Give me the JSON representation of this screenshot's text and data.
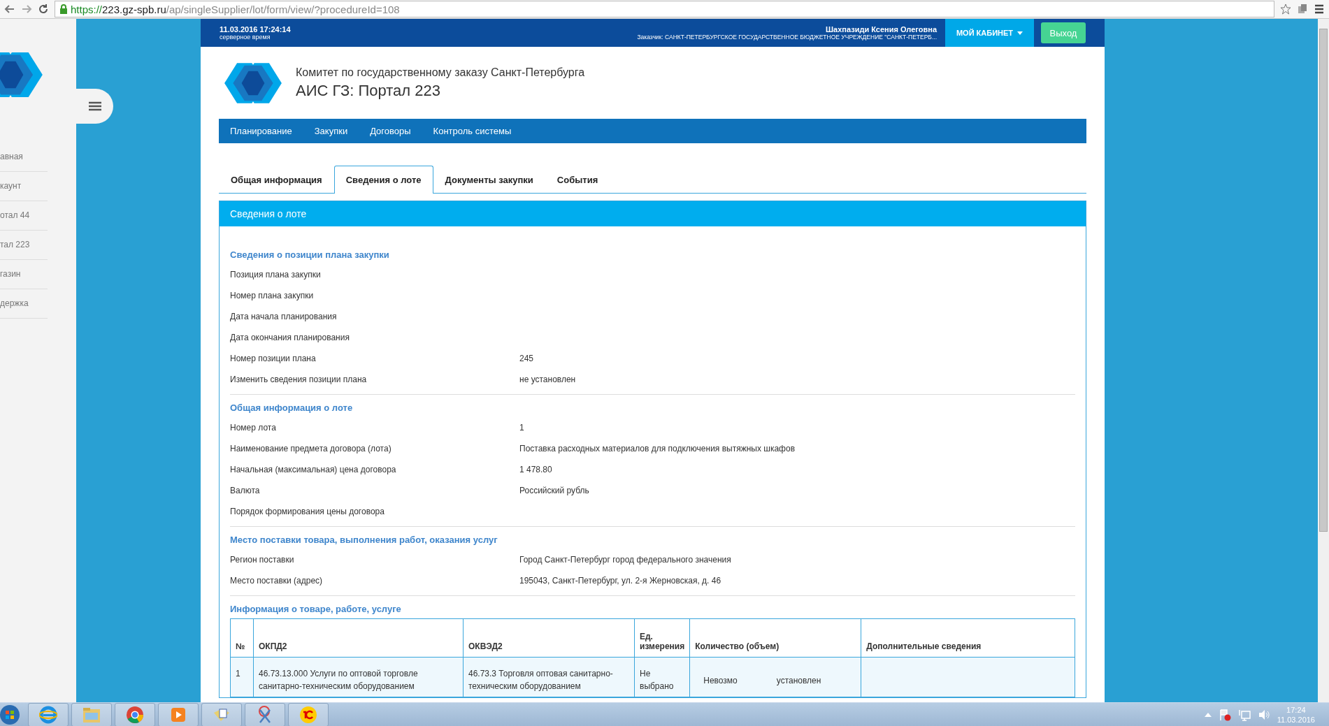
{
  "browser": {
    "url_scheme": "https://",
    "url_host": "223.gz-spb.ru",
    "url_path": "/ap/singleSupplier/lot/form/view/?procedureId=108"
  },
  "sidebar": {
    "items": [
      {
        "label": "авная"
      },
      {
        "label": "каунт"
      },
      {
        "label": "отал 44"
      },
      {
        "label": "тал 223"
      },
      {
        "label": "газин"
      },
      {
        "label": "держка"
      }
    ]
  },
  "topbar": {
    "datetime": "11.03.2016 17:24:14",
    "datetime_note": "серверное время",
    "user": "Шахпазиди Ксения Олеговна",
    "customer": "Заказчик: САНКТ-ПЕТЕРБУРГСКОЕ ГОСУДАРСТВЕННОЕ БЮДЖЕТНОЕ УЧРЕЖДЕНИЕ \"САНКТ-ПЕТЕРБ...",
    "cabinet_button": "МОЙ КАБИНЕТ",
    "logout_button": "Выход"
  },
  "header": {
    "org": "Комитет по государственному заказу Санкт-Петербурга",
    "title": "АИС ГЗ: Портал 223"
  },
  "nav": [
    "Планирование",
    "Закупки",
    "Договоры",
    "Контроль системы"
  ],
  "tabs": [
    {
      "label": "Общая информация",
      "selected": false
    },
    {
      "label": "Сведения о лоте",
      "selected": true
    },
    {
      "label": "Документы закупки",
      "selected": false
    },
    {
      "label": "События",
      "selected": false
    }
  ],
  "panel": {
    "title": "Сведения о лоте",
    "sections": [
      {
        "title": "Сведения о позиции плана закупки",
        "rows": [
          {
            "label": "Позиция плана закупки"
          },
          {
            "label": "Номер плана закупки"
          },
          {
            "label": "Дата начала планирования"
          },
          {
            "label": "Дата окончания планирования"
          },
          {
            "label": "Номер позиции плана",
            "value": "245"
          },
          {
            "label": "Изменить сведения позиции плана",
            "value": "не установлен"
          }
        ]
      },
      {
        "title": "Общая информация о лоте",
        "rows": [
          {
            "label": "Номер лота",
            "value": "1"
          },
          {
            "label": "Наименование предмета договора (лота)",
            "value": "Поставка расходных материалов для подключения вытяжных шкафов"
          },
          {
            "label": "Начальная (максимальная) цена договора",
            "value": "1 478.80"
          },
          {
            "label": "Валюта",
            "value": "Российский рубль"
          },
          {
            "label": "Порядок формирования цены договора"
          }
        ]
      },
      {
        "title": "Место поставки товара, выполнения работ, оказания услуг",
        "rows": [
          {
            "label": "Регион поставки",
            "value": "Город Санкт-Петербург город федерального значения"
          },
          {
            "label": "Место поставки (адрес)",
            "value": "195043, Санкт-Петербург, ул. 2-я Жерновская, д. 46"
          }
        ]
      }
    ],
    "table_title": "Информация о товаре, работе, услуге",
    "table": {
      "columns": [
        "№",
        "ОКПД2",
        "ОКВЭД2",
        "Ед. измерения",
        "Количество (объем)",
        "Дополнительные сведения"
      ],
      "rows": [
        [
          "1",
          "46.73.13.000 Услуги по оптовой торговле санитарно-техническим оборудованием",
          "46.73.3 Торговля оптовая санитарно-техническим оборудованием",
          "Не выбрано",
          [
            "Невозмо",
            "установлен"
          ],
          ""
        ]
      ]
    }
  },
  "taskbar": {
    "time": "17:24",
    "date": "11.03.2016"
  }
}
